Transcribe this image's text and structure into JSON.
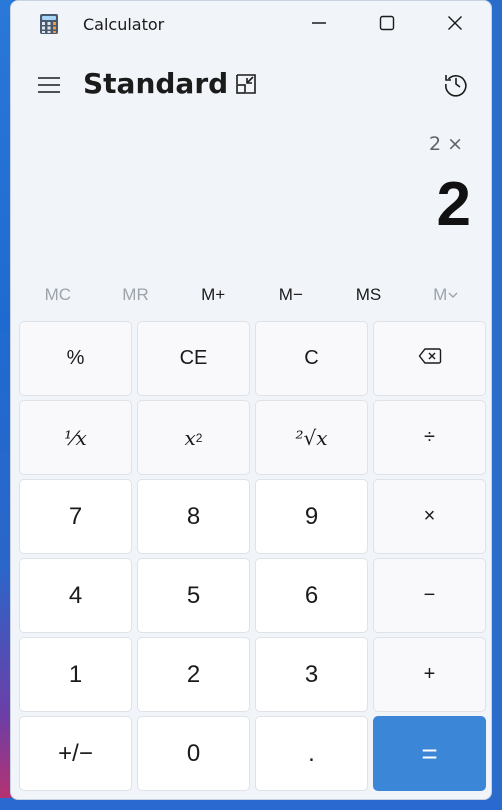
{
  "window": {
    "title": "Calculator",
    "mode": "Standard"
  },
  "display": {
    "expression": "2 ×",
    "result": "2"
  },
  "memory": {
    "mc": "MC",
    "mr": "MR",
    "m_plus": "M+",
    "m_minus": "M−",
    "ms": "MS",
    "m_list": "M"
  },
  "keys": {
    "percent": "%",
    "ce": "CE",
    "c": "C",
    "reciprocal": "⅟x",
    "square": "x",
    "square_exp": "2",
    "sqrt": "²√x",
    "divide": "÷",
    "seven": "7",
    "eight": "8",
    "nine": "9",
    "multiply": "×",
    "four": "4",
    "five": "5",
    "six": "6",
    "minus": "−",
    "one": "1",
    "two": "2",
    "three": "3",
    "plus": "+",
    "negate": "+/−",
    "zero": "0",
    "decimal": ".",
    "equals": "="
  },
  "colors": {
    "accent": "#3b86d6",
    "window_bg": "#f1f4f9",
    "number_key": "#ffffff",
    "function_key": "#f9f9fb"
  },
  "icons": {
    "app": "calculator-icon",
    "minimize": "minimize-icon",
    "maximize": "maximize-icon",
    "close": "close-icon",
    "menu": "hamburger-icon",
    "keep_on_top": "keep-on-top-icon",
    "history": "history-icon",
    "backspace": "backspace-icon",
    "memory_dropdown": "chevron-down-icon"
  }
}
